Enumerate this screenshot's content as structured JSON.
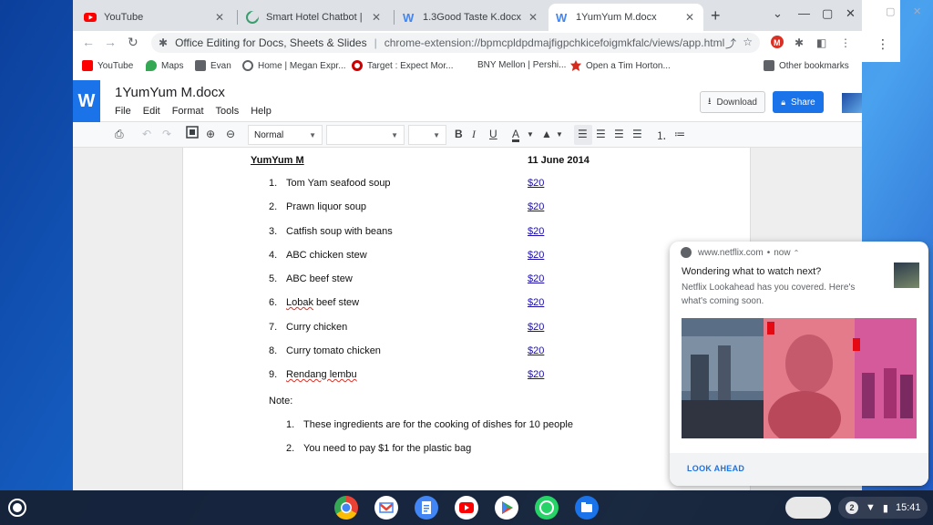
{
  "browser": {
    "tabs": [
      {
        "title": "YouTube"
      },
      {
        "title": "Smart Hotel Chatbot | Quick"
      },
      {
        "title": "1.3Good Taste K.docx"
      },
      {
        "title": "1YumYum M.docx"
      }
    ],
    "omnibox": {
      "app_name": "Office Editing for Docs, Sheets & Slides",
      "url": "chrome-extension://bpmcpldpdmajfigpchkicefoigmkfalc/views/app.html"
    },
    "bookmarks": [
      {
        "label": "YouTube"
      },
      {
        "label": "Maps"
      },
      {
        "label": "Evan"
      },
      {
        "label": "Home | Megan Expr..."
      },
      {
        "label": "Target : Expect Mor..."
      },
      {
        "label": "BNY Mellon | Pershi..."
      },
      {
        "label": "Open a Tim Horton..."
      },
      {
        "label": "Other bookmarks"
      }
    ]
  },
  "docs": {
    "logo": "W",
    "doc_name": "1YumYum M.docx",
    "menu": [
      "File",
      "Edit",
      "Format",
      "Tools",
      "Help"
    ],
    "download_label": "Download",
    "share_label": "Share",
    "style_select": "Normal"
  },
  "document": {
    "heading": "YumYum M",
    "date": "11 June 2014",
    "items": [
      {
        "num": "1.",
        "name": "Tom Yam seafood soup",
        "price": "$20"
      },
      {
        "num": "2.",
        "name": "Prawn liquor soup",
        "price": "$20"
      },
      {
        "num": "3.",
        "name": "Catfish soup with beans",
        "price": "$20"
      },
      {
        "num": "4.",
        "name": "ABC chicken stew",
        "price": "$20"
      },
      {
        "num": "5.",
        "name": "ABC beef stew",
        "price": "$20"
      },
      {
        "num": "6.",
        "name_a": "Lobak",
        "name_b": " beef stew",
        "price": "$20"
      },
      {
        "num": "7.",
        "name": "Curry chicken",
        "price": "$20"
      },
      {
        "num": "8.",
        "name": "Curry tomato chicken",
        "price": "$20"
      },
      {
        "num": "9.",
        "name": "Rendang lembu",
        "price": "$20"
      }
    ],
    "note_label": "Note:",
    "notes": [
      {
        "num": "1.",
        "text": "These ingredients are for the cooking of dishes for 10 people"
      },
      {
        "num": "2.",
        "text": "You need to pay $1 for the plastic bag"
      }
    ]
  },
  "notification": {
    "source": "www.netflix.com",
    "time": "now",
    "title": "Wondering what to watch next?",
    "body": "Netflix Lookahead has you covered. Here's what's coming soon.",
    "action": "LOOK AHEAD"
  },
  "shelf": {
    "badge": "2",
    "time": "15:41"
  }
}
